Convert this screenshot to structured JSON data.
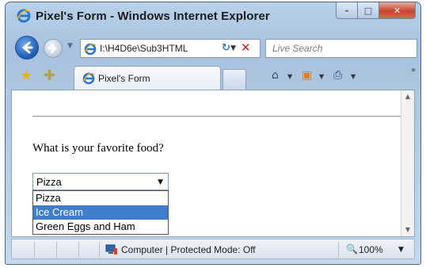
{
  "window": {
    "title": "Pixel's Form - Windows Internet Explorer",
    "caption": {
      "minimize": "–",
      "maximize": "□",
      "close": "✕"
    }
  },
  "addressbar": {
    "url": "I:\\H4D6e\\Sub3HTML",
    "search_placeholder": "Live Search"
  },
  "tabs": [
    {
      "label": "Pixel's Form"
    }
  ],
  "page": {
    "question": "What is your favorite food?",
    "select": {
      "selected_value": "Pizza",
      "options": [
        "Pizza",
        "Ice Cream",
        "Green Eggs and Ham"
      ],
      "highlighted_option": "Ice Cream"
    }
  },
  "statusbar": {
    "zone": "Computer | Protected Mode: Off",
    "zoom": "100%"
  },
  "icons": {
    "ie": "ie-logo-icon",
    "favorites": "favorites-star-icon",
    "add_favorites": "add-favorites-icon",
    "home": "home-icon",
    "feeds": "feeds-icon",
    "print": "print-icon",
    "refresh": "refresh-icon",
    "stop": "stop-icon",
    "zone": "computer-zone-icon",
    "zoom": "zoom-icon"
  },
  "colors": {
    "selection": "#3f7ecb",
    "close_button": "#c8452f",
    "chrome": "#b9d1ea"
  }
}
